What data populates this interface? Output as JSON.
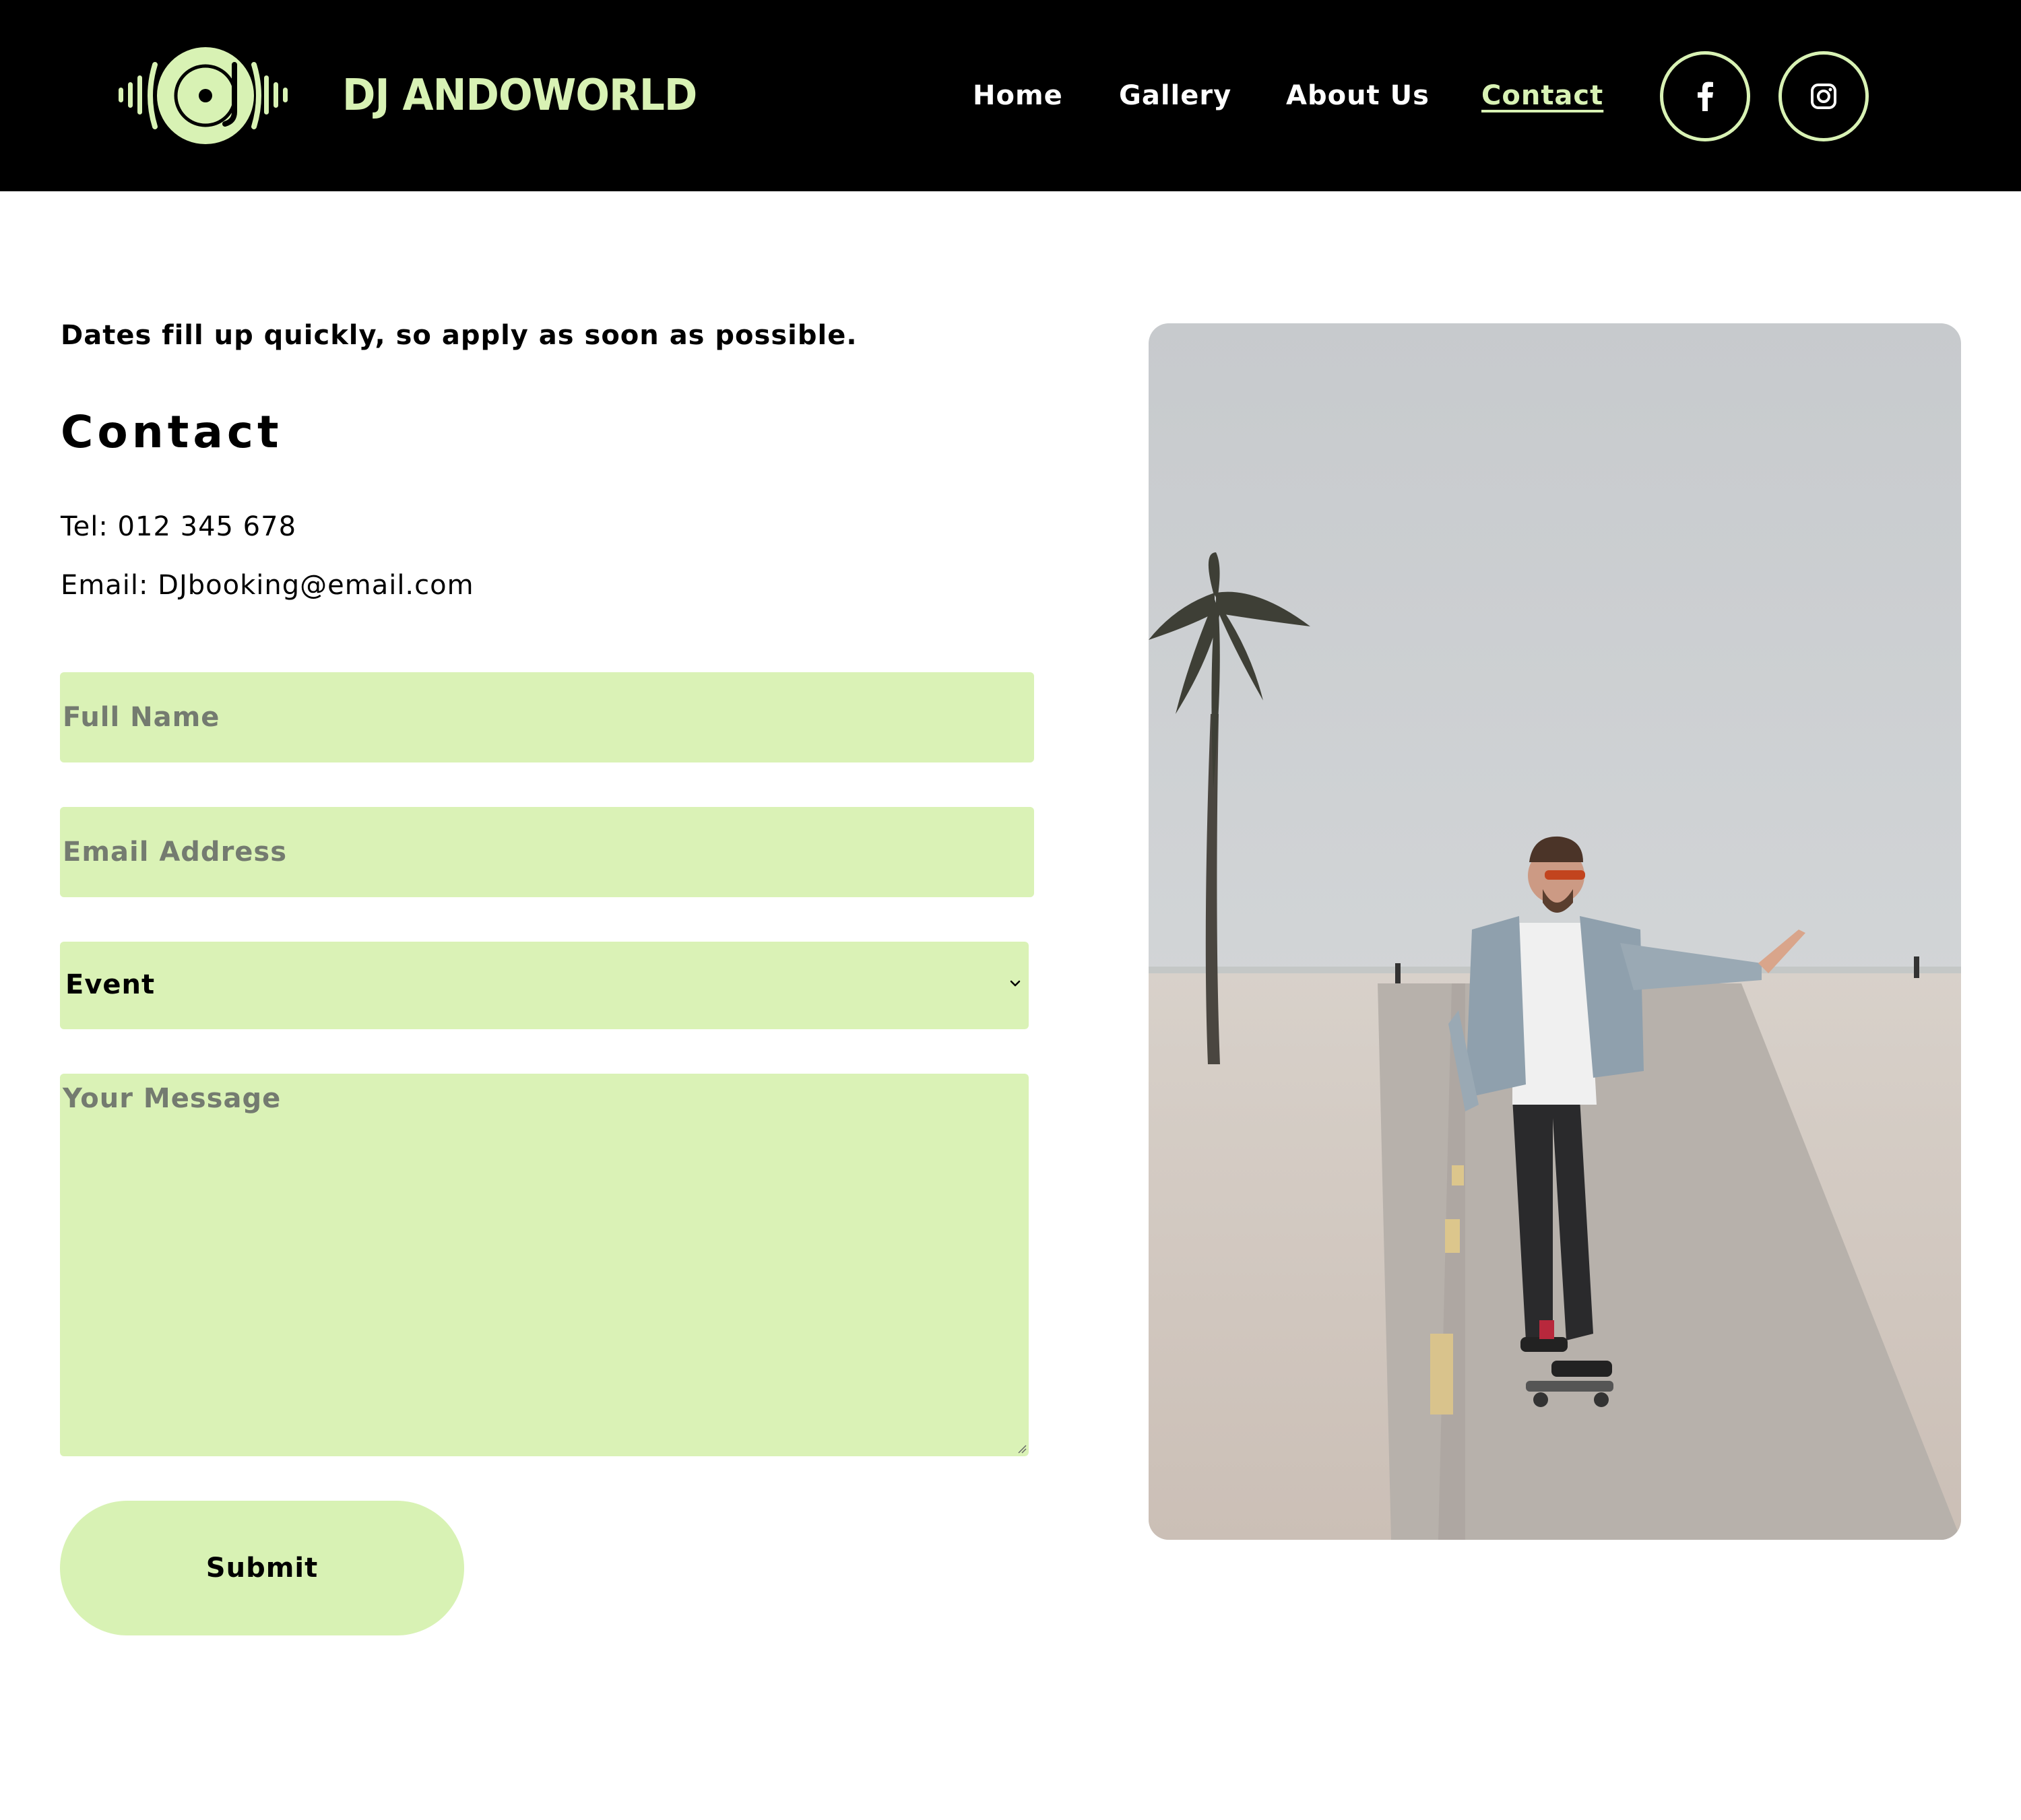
{
  "header": {
    "brand": "DJ ANDOWORLD",
    "logo_icon": "turntable-soundwave-icon",
    "nav": [
      {
        "label": "Home",
        "active": false
      },
      {
        "label": "Gallery",
        "active": false
      },
      {
        "label": "About Us",
        "active": false
      },
      {
        "label": "Contact",
        "active": true
      }
    ],
    "social": [
      {
        "icon": "facebook-icon"
      },
      {
        "icon": "instagram-icon"
      }
    ]
  },
  "main": {
    "tagline": "Dates fill up quickly, so apply as soon as possible.",
    "heading": "Contact",
    "tel": "Tel: 012 345 678",
    "email": "Email: DJbooking@email.com"
  },
  "form": {
    "name_placeholder": "Full Name",
    "email_placeholder": "Email Address",
    "event_selected": "Event",
    "message_placeholder": "Your Message",
    "submit_label": "Submit"
  },
  "colors": {
    "header_bg": "#000000",
    "accent": "#d8f2b4",
    "field_bg": "#daf2b6",
    "placeholder": "#747b70"
  }
}
